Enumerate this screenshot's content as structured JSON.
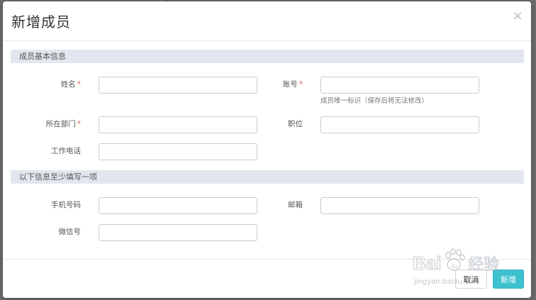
{
  "dialog": {
    "title": "新增成员",
    "close_glyph": "×"
  },
  "sections": {
    "basic": {
      "title": "成员基本信息",
      "fields": {
        "name": {
          "label": "姓名",
          "required": true,
          "value": "",
          "placeholder": ""
        },
        "account": {
          "label": "账号",
          "required": true,
          "value": "",
          "placeholder": "",
          "help": "成员唯一标识（保存后将无法修改）"
        },
        "department": {
          "label": "所在部门",
          "required": true,
          "value": "",
          "placeholder": ""
        },
        "position": {
          "label": "职位",
          "required": false,
          "value": "",
          "placeholder": ""
        },
        "work_phone": {
          "label": "工作电话",
          "required": false,
          "value": "",
          "placeholder": ""
        }
      }
    },
    "contact": {
      "title": "以下信息至少填写一项",
      "fields": {
        "mobile": {
          "label": "手机号码",
          "value": "",
          "placeholder": ""
        },
        "email": {
          "label": "邮箱",
          "value": "",
          "placeholder": ""
        },
        "wechat": {
          "label": "微信号",
          "value": "",
          "placeholder": ""
        }
      }
    }
  },
  "footer": {
    "cancel_label": "取消",
    "submit_label": "新增"
  },
  "required_marker": "*",
  "watermark": {
    "brand": "Bai",
    "paw": "du",
    "cn": "经验",
    "url": "jingyan.baidu.com",
    "icon": "baidu-paw-icon"
  },
  "colors": {
    "primary": "#3ec1cf",
    "section_bg": "#e2e6ee",
    "required": "#e05a5a",
    "overlay": "#6f6f6f"
  }
}
